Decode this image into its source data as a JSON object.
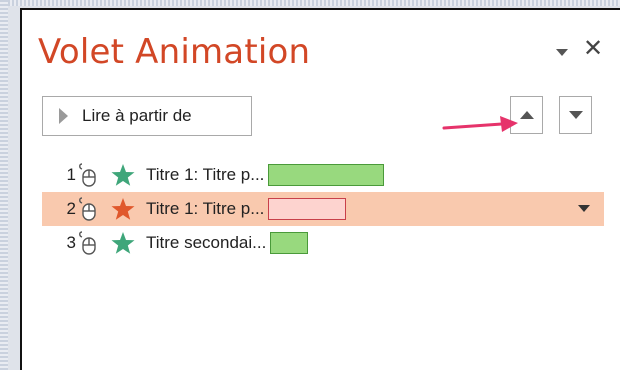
{
  "pane": {
    "title": "Volet Animation",
    "menu_icon": "chevron-down-icon",
    "close_label": "✕"
  },
  "toolbar": {
    "play_label": "Lire à partir de",
    "move_up_icon": "triangle-up-icon",
    "move_down_icon": "triangle-down-icon"
  },
  "annotation": {
    "color": "#e6336b"
  },
  "animations": [
    {
      "number": "1",
      "label": "Titre 1: Titre p...",
      "star_color": "#3fa67a",
      "bar_fill": "#98d97e",
      "bar_border": "#4a9a3a",
      "selected": false
    },
    {
      "number": "2",
      "label": "Titre 1: Titre p...",
      "star_color": "#e0582c",
      "bar_fill": "#fdd3cf",
      "bar_border": "#c8404a",
      "selected": true
    },
    {
      "number": "3",
      "label": "Titre secondai...",
      "star_color": "#3fa67a",
      "bar_fill": "#98d97e",
      "bar_border": "#4a9a3a",
      "selected": false
    }
  ],
  "colors": {
    "title": "#d24726",
    "selected_row": "#f9c9ae"
  }
}
